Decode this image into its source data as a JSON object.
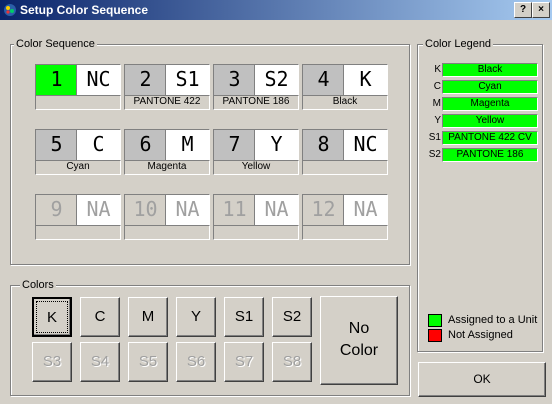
{
  "window": {
    "title": "Setup Color Sequence",
    "help_label": "?",
    "close_label": "×"
  },
  "sequence": {
    "label": "Color Sequence",
    "cells": [
      {
        "num": "1",
        "code": "NC",
        "name": "",
        "active": true,
        "na": false
      },
      {
        "num": "2",
        "code": "S1",
        "name": "PANTONE 422",
        "active": false,
        "na": false
      },
      {
        "num": "3",
        "code": "S2",
        "name": "PANTONE 186",
        "active": false,
        "na": false
      },
      {
        "num": "4",
        "code": "K",
        "name": "Black",
        "active": false,
        "na": false
      },
      {
        "num": "5",
        "code": "C",
        "name": "Cyan",
        "active": false,
        "na": false
      },
      {
        "num": "6",
        "code": "M",
        "name": "Magenta",
        "active": false,
        "na": false
      },
      {
        "num": "7",
        "code": "Y",
        "name": "Yellow",
        "active": false,
        "na": false
      },
      {
        "num": "8",
        "code": "NC",
        "name": "",
        "active": false,
        "na": false
      },
      {
        "num": "9",
        "code": "NA",
        "name": "",
        "active": false,
        "na": true
      },
      {
        "num": "10",
        "code": "NA",
        "name": "",
        "active": false,
        "na": true
      },
      {
        "num": "11",
        "code": "NA",
        "name": "",
        "active": false,
        "na": true
      },
      {
        "num": "12",
        "code": "NA",
        "name": "",
        "active": false,
        "na": true
      }
    ]
  },
  "colors": {
    "label": "Colors",
    "buttons": [
      {
        "label": "K",
        "enabled": true,
        "focused": true
      },
      {
        "label": "C",
        "enabled": true,
        "focused": false
      },
      {
        "label": "M",
        "enabled": true,
        "focused": false
      },
      {
        "label": "Y",
        "enabled": true,
        "focused": false
      },
      {
        "label": "S1",
        "enabled": true,
        "focused": false
      },
      {
        "label": "S2",
        "enabled": true,
        "focused": false
      },
      {
        "label": "S3",
        "enabled": false,
        "focused": false
      },
      {
        "label": "S4",
        "enabled": false,
        "focused": false
      },
      {
        "label": "S5",
        "enabled": false,
        "focused": false
      },
      {
        "label": "S6",
        "enabled": false,
        "focused": false
      },
      {
        "label": "S7",
        "enabled": false,
        "focused": false
      },
      {
        "label": "S8",
        "enabled": false,
        "focused": false
      }
    ],
    "no_color_line1": "No",
    "no_color_line2": "Color"
  },
  "legend": {
    "label": "Color Legend",
    "rows": [
      {
        "key": "K",
        "value": "Black"
      },
      {
        "key": "C",
        "value": "Cyan"
      },
      {
        "key": "M",
        "value": "Magenta"
      },
      {
        "key": "Y",
        "value": "Yellow"
      },
      {
        "key": "S1",
        "value": "PANTONE 422 CV"
      },
      {
        "key": "S2",
        "value": "PANTONE 186"
      }
    ],
    "assigned_label": "Assigned to a Unit",
    "not_assigned_label": "Not Assigned",
    "assigned_color": "#00ff00",
    "not_assigned_color": "#ff0000"
  },
  "ok_label": "OK"
}
